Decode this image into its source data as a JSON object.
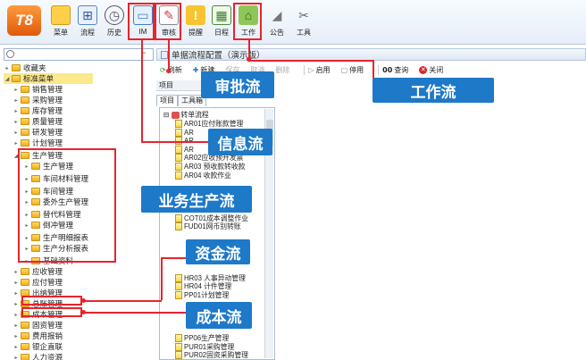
{
  "toolbar": {
    "logo": "T8",
    "buttons": [
      {
        "label": "菜单",
        "icon": "menu-icon"
      },
      {
        "label": "流程",
        "icon": "flow-icon"
      },
      {
        "label": "历史",
        "icon": "history-icon"
      },
      {
        "label": "IM",
        "icon": "im-icon"
      },
      {
        "label": "审核",
        "icon": "review-icon"
      },
      {
        "label": "提醒",
        "icon": "reminder-icon"
      },
      {
        "label": "日程",
        "icon": "calendar-icon"
      },
      {
        "label": "工作",
        "icon": "work-icon"
      },
      {
        "label": "公告",
        "icon": "notice-icon"
      },
      {
        "label": "工具",
        "icon": "tools-icon"
      }
    ]
  },
  "tree": {
    "items": [
      {
        "label": "收藏夹"
      },
      {
        "label": "标准菜单"
      },
      {
        "label": "销售管理"
      },
      {
        "label": "采购管理"
      },
      {
        "label": "库存管理"
      },
      {
        "label": "质量管理"
      },
      {
        "label": "研发管理"
      },
      {
        "label": "计划管理"
      },
      {
        "label": "生产管理"
      },
      {
        "label": "生产管理"
      },
      {
        "label": "车间材料管理"
      },
      {
        "label": "车间管理"
      },
      {
        "label": "委外生产管理"
      },
      {
        "label": "替代料管理"
      },
      {
        "label": "倒冲管理"
      },
      {
        "label": "生产明细报表"
      },
      {
        "label": "生产分析报表"
      },
      {
        "label": "基础资料"
      },
      {
        "label": "应收管理"
      },
      {
        "label": "应付管理"
      },
      {
        "label": "出纳管理"
      },
      {
        "label": "总账管理"
      },
      {
        "label": "成本管理"
      },
      {
        "label": "固资管理"
      },
      {
        "label": "费用报销"
      },
      {
        "label": "银企直联"
      },
      {
        "label": "人力资源"
      }
    ]
  },
  "panel": {
    "title": "单据流程配置（演示版）",
    "toolbar": {
      "refresh": "刷新",
      "new": "新建",
      "save": "保存",
      "cancel": "取消",
      "delete": "删除",
      "enable": "启用",
      "disable": "停用",
      "query": "查询",
      "close": "关闭"
    },
    "label": "项目",
    "tabs": [
      "项目",
      "工具箱"
    ],
    "tree_root": "转单流程",
    "tree_items": [
      "AR01应付账款管理",
      "AR",
      "AR",
      "AR",
      "AR02应收预开发票",
      "AR03 预收款转收款",
      "AR04 收款作业",
      "",
      "",
      "",
      "",
      "COT01成本调整作业",
      "FUD01网币别转账",
      "",
      "",
      "",
      "",
      "",
      "HR03 人事异动管理",
      "HR04 计件管理",
      "PP01计划管理",
      "",
      "",
      "",
      "",
      "PP06生产管理",
      "PUR01采购管理",
      "PUR02固资采购管理"
    ]
  },
  "callouts": {
    "approval_flow": "审批流",
    "work_flow": "工作流",
    "info_flow": "信息流",
    "business_flow": "业务生产流",
    "fund_flow": "资金流",
    "cost_flow": "成本流"
  },
  "colors": {
    "callout_bg": "#1e79c8",
    "highlight": "#e8232c",
    "selected_row": "#fbe98c"
  }
}
